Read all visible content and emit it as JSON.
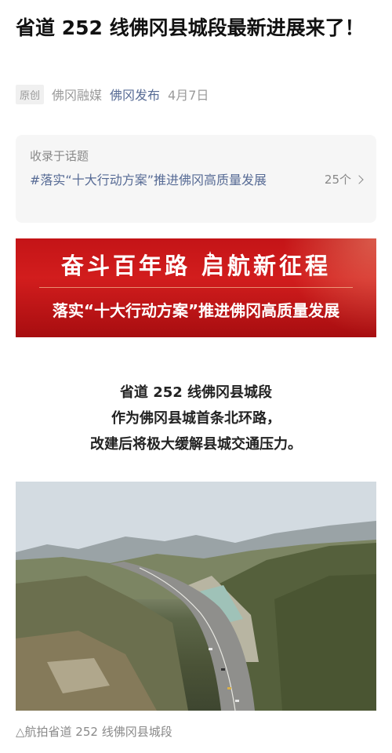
{
  "article": {
    "title": "省道 252 线佛冈县城段最新进展来了！",
    "meta": {
      "tag": "原创",
      "source": "佛冈融媒",
      "account": "佛冈发布",
      "date": "4月7日"
    },
    "topic": {
      "label": "收录于话题",
      "name": "#落实“十大行动方案”推进佛冈高质量发展",
      "count": "25个"
    },
    "banner": {
      "top_text": "奋斗百年路 启航新征程",
      "bottom_text": "落实“十大行动方案”推进佛冈高质量发展"
    },
    "lead_lines": [
      "省道 252 线佛冈县城段",
      "作为佛冈县城首条北环路，",
      "改建后将极大缓解县城交通压力。"
    ],
    "photo_caption": "△航拍省道 252 线佛冈县城段"
  },
  "colors": {
    "link": "#576b95",
    "banner_red": "#c41417",
    "muted": "#9a9a9a"
  }
}
